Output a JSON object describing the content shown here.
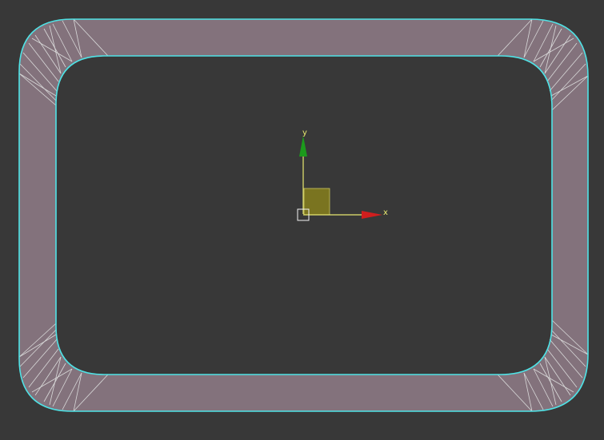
{
  "viewport": {
    "background_color": "#383838"
  },
  "mesh": {
    "fill_color": "#83727c",
    "selection_outline_color": "#4fe3e6",
    "wire_color": "#d9d9d9"
  },
  "gizmo": {
    "x_axis_label": "x",
    "y_axis_label": "y",
    "x_color": "#d01e1e",
    "y_color": "#1c9a1c",
    "axis_line_color": "#e8e870",
    "plane_handle_color": "#7a7420"
  }
}
